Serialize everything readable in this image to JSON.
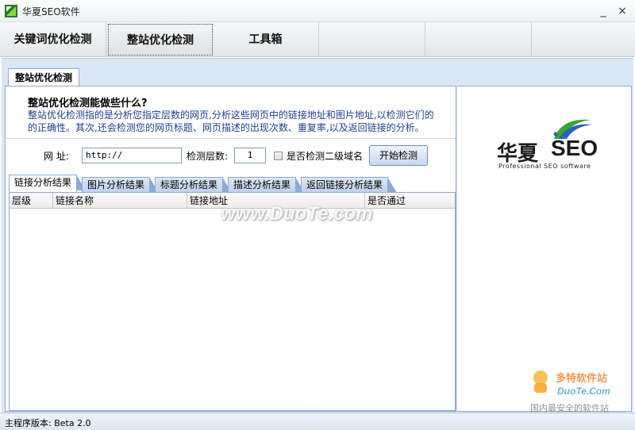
{
  "window": {
    "title": "华夏SEO软件",
    "minimize_glyph": "_",
    "close_glyph": "×"
  },
  "main_tabs": [
    {
      "label": "关键词优化检测"
    },
    {
      "label": "整站优化检测"
    },
    {
      "label": "工具箱"
    },
    {
      "label": ""
    },
    {
      "label": ""
    },
    {
      "label": ""
    }
  ],
  "subtab": {
    "label": "整站优化检测"
  },
  "intro": {
    "heading": "整站优化检测能做些什么?",
    "line1": "整站优化检测指的是分析您指定层数的网页,分析这些网页中的链接地址和图片地址,以检测它们的",
    "line2": "的正确性。其次,还会检测您的网页标题、网页描述的出现次数、重复率,以及返回链接的分析。"
  },
  "form": {
    "url_label": "网  址:",
    "url_value": "http://",
    "depth_label": "检测层数:",
    "depth_value": "1",
    "subdomain_label": "是否检测二级域名",
    "start_button": "开始检测"
  },
  "result_tabs": [
    {
      "label": "链接分析结果"
    },
    {
      "label": "图片分析结果"
    },
    {
      "label": "标题分析结果"
    },
    {
      "label": "描述分析结果"
    },
    {
      "label": "返回链接分析结果"
    }
  ],
  "grid": {
    "columns": [
      "层级",
      "链接名称",
      "链接地址",
      "是否通过"
    ]
  },
  "logo": {
    "text_cn": "华夏",
    "text_seo": "SEO",
    "tagline": "Professional SEO software"
  },
  "watermarks": {
    "center": "www.DuoTe.com",
    "corner_brand": "多特软件站",
    "corner_site": "DuoTe.Com",
    "corner_slogan": "国内最安全的软件站"
  },
  "status": {
    "text": "主程序版本: Beta 2.0"
  },
  "colors": {
    "accent_blue": "#1f3f8f",
    "frame": "#d9e6f6",
    "logo_green": "#3aa335"
  }
}
